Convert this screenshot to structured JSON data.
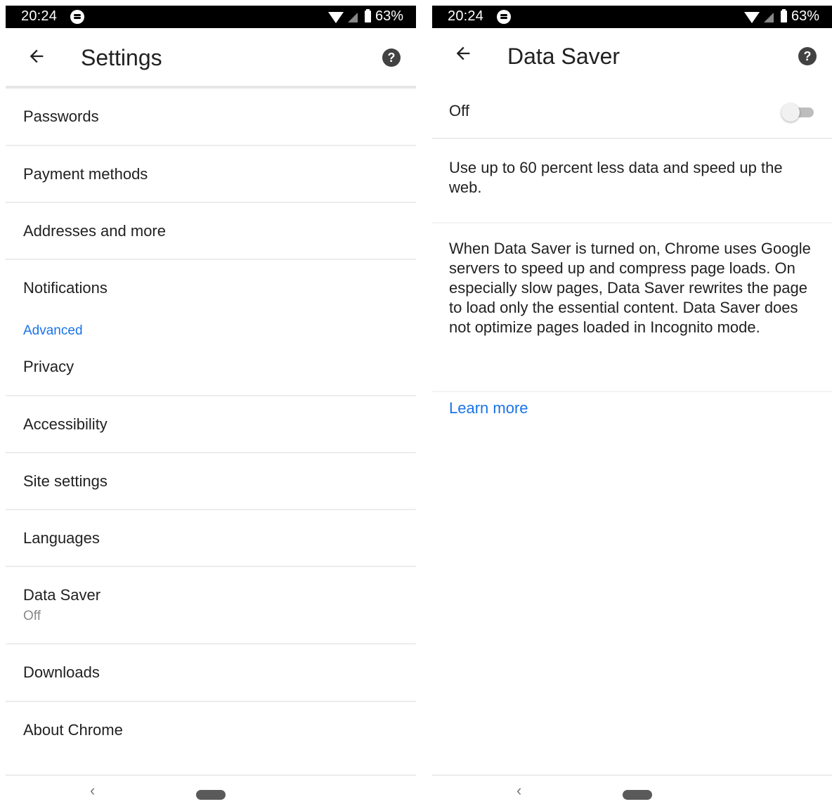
{
  "statusbar": {
    "time": "20:24",
    "battery": "63%"
  },
  "left": {
    "title": "Settings",
    "items_top": [
      {
        "label": "Passwords"
      },
      {
        "label": "Payment methods"
      },
      {
        "label": "Addresses and more"
      },
      {
        "label": "Notifications"
      }
    ],
    "section_header": "Advanced",
    "items_advanced": [
      {
        "label": "Privacy"
      },
      {
        "label": "Accessibility"
      },
      {
        "label": "Site settings"
      },
      {
        "label": "Languages"
      },
      {
        "label": "Data Saver",
        "secondary": "Off"
      },
      {
        "label": "Downloads"
      },
      {
        "label": "About Chrome"
      }
    ]
  },
  "right": {
    "title": "Data Saver",
    "switch_label": "Off",
    "switch_on": false,
    "summary": "Use up to 60 percent less data and speed up the web.",
    "description": "When Data Saver is turned on, Chrome uses Google servers to speed up and compress page loads. On especially slow pages, Data Saver rewrites the page to load only the essential content. Data Saver does not optimize pages loaded in Incognito mode.",
    "learn_more": "Learn more"
  },
  "nav": {
    "back_glyph": "‹"
  },
  "colors": {
    "accent": "#1a73e8",
    "statusbar": "#000000"
  }
}
